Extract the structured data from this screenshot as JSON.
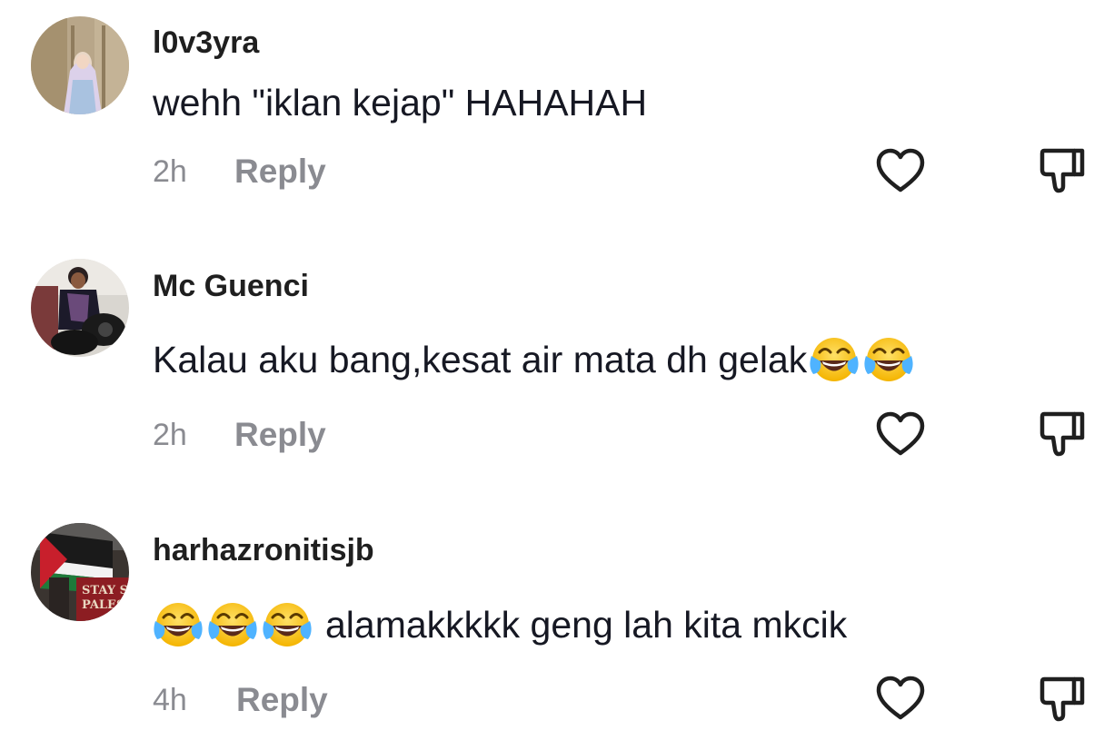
{
  "comments": [
    {
      "username": "l0v3yra",
      "text": "wehh \"iklan kejap\" HAHAHAH",
      "time": "2h",
      "reply_label": "Reply",
      "avatar": "person-in-hijab-photo"
    },
    {
      "username": "Mc Guenci",
      "text": "Kalau aku bang,kesat air mata dh gelak",
      "emoji_after": [
        "face-with-tears-of-joy",
        "face-with-tears-of-joy"
      ],
      "time": "2h",
      "reply_label": "Reply",
      "avatar": "person-on-motorcycle-photo"
    },
    {
      "username": "harhazronitisjb",
      "emoji_before": [
        "face-with-tears-of-joy",
        "face-with-tears-of-joy",
        "face-with-tears-of-joy"
      ],
      "text": "alamakkkkk geng lah kita mkcik",
      "time": "4h",
      "reply_label": "Reply",
      "avatar": "palestine-flag-photo",
      "avatar_text": "STAY STR PALES"
    }
  ],
  "icons": {
    "like": "heart-outline-icon",
    "dislike": "thumbs-down-icon"
  },
  "colors": {
    "meta": "#8a8b91",
    "text": "#161823",
    "icon": "#1f1f1f"
  }
}
